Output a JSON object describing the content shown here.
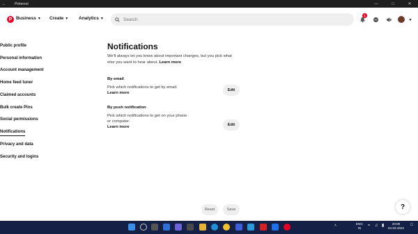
{
  "window": {
    "title": "Pinterest",
    "back_glyph": "←"
  },
  "header": {
    "nav": [
      {
        "label": "Business"
      },
      {
        "label": "Create"
      },
      {
        "label": "Analytics"
      }
    ],
    "search_placeholder": "Search",
    "notification_count": "1",
    "brand_color": "#e60023"
  },
  "sidebar": {
    "items": [
      {
        "label": "Public profile"
      },
      {
        "label": "Personal information"
      },
      {
        "label": "Account management"
      },
      {
        "label": "Home feed tuner"
      },
      {
        "label": "Claimed accounts"
      },
      {
        "label": "Bulk create Pins"
      },
      {
        "label": "Social permissions"
      },
      {
        "label": "Notifications"
      },
      {
        "label": "Privacy and data"
      },
      {
        "label": "Security and logins"
      }
    ],
    "active_index": 7
  },
  "main": {
    "title": "Notifications",
    "intro_text": "We'll always let you know about important changes, but you pick what else you want to hear about.",
    "intro_link": "Learn more",
    "sections": [
      {
        "title": "By email",
        "description": "Pick which notifications to get by email.",
        "link": "Learn more",
        "button": "Edit"
      },
      {
        "title": "By push notification",
        "description": "Pick which notifications to get on your phone or computer.",
        "link": "Learn more",
        "button": "Edit"
      }
    ]
  },
  "footer": {
    "reset_label": "Reset",
    "save_label": "Save",
    "help_label": "?"
  },
  "taskbar": {
    "language": "ENG",
    "region": "IN",
    "time": "20:08",
    "date": "04-03-2022"
  }
}
